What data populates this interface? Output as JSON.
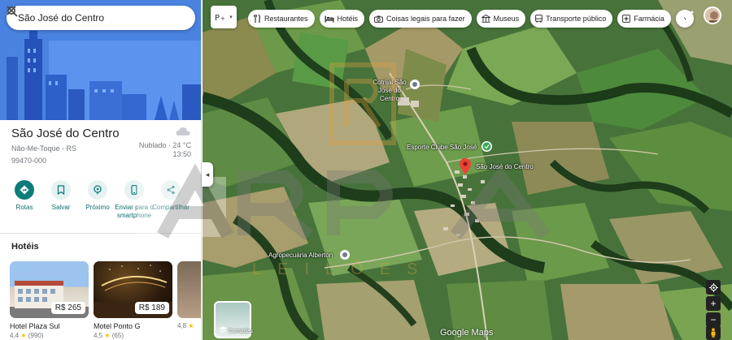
{
  "search": {
    "value": "São José do Centro",
    "search_icon": "search-icon",
    "close_icon": "close-icon"
  },
  "place": {
    "title": "São José do Centro",
    "region": "Não-Me-Toque - RS",
    "postal_code": "99470-000",
    "weather": {
      "condition": "Nublado · 24 °C",
      "time": "13:50",
      "icon": "cloud-icon"
    }
  },
  "actions": [
    {
      "label": "Rotas",
      "icon": "directions-icon"
    },
    {
      "label": "Salvar",
      "icon": "bookmark-icon"
    },
    {
      "label": "Próximo",
      "icon": "nearby-icon"
    },
    {
      "label": "Enviar para o smartphone",
      "icon": "phone-icon"
    },
    {
      "label": "Compartilhar",
      "icon": "share-icon"
    }
  ],
  "hotels": {
    "heading": "Hotéis",
    "items": [
      {
        "name": "Hotel Plaza Sul",
        "price": "R$ 265",
        "rating": "4,4",
        "reviews": "(990)"
      },
      {
        "name": "Motel Ponto G",
        "price": "R$ 189",
        "rating": "4,5",
        "reviews": "(65)"
      },
      {
        "name": "",
        "price": "",
        "rating": "4,8",
        "reviews": ""
      }
    ]
  },
  "map": {
    "chips": [
      {
        "label": "Restaurantes",
        "icon": "fork-knife-icon"
      },
      {
        "label": "Hotéis",
        "icon": "bed-icon"
      },
      {
        "label": "Coisas legais para fazer",
        "icon": "camera-icon"
      },
      {
        "label": "Museus",
        "icon": "museum-icon"
      },
      {
        "label": "Transporte público",
        "icon": "bus-icon"
      },
      {
        "label": "Farmácia",
        "icon": "pharmacy-icon"
      }
    ],
    "markers": [
      {
        "label": "Cotrijal São José do Centro",
        "line1": "Cotrijal São",
        "line2": "José do Centro"
      },
      {
        "label": "Esporte Clube São José"
      },
      {
        "label": "São José do Centro"
      },
      {
        "label": "Agropecuária Alberton"
      }
    ],
    "layers_label": "Camadas",
    "logo": "Google Maps",
    "zoom_in": "+",
    "zoom_out": "−"
  },
  "watermark": {
    "text": "ARPA",
    "subtitle": "LEILÕES"
  },
  "colors": {
    "accent": "#0b7c7a",
    "pin_red": "#ea4335",
    "pin_green": "#34a853",
    "map_base": "#3e6a33"
  }
}
